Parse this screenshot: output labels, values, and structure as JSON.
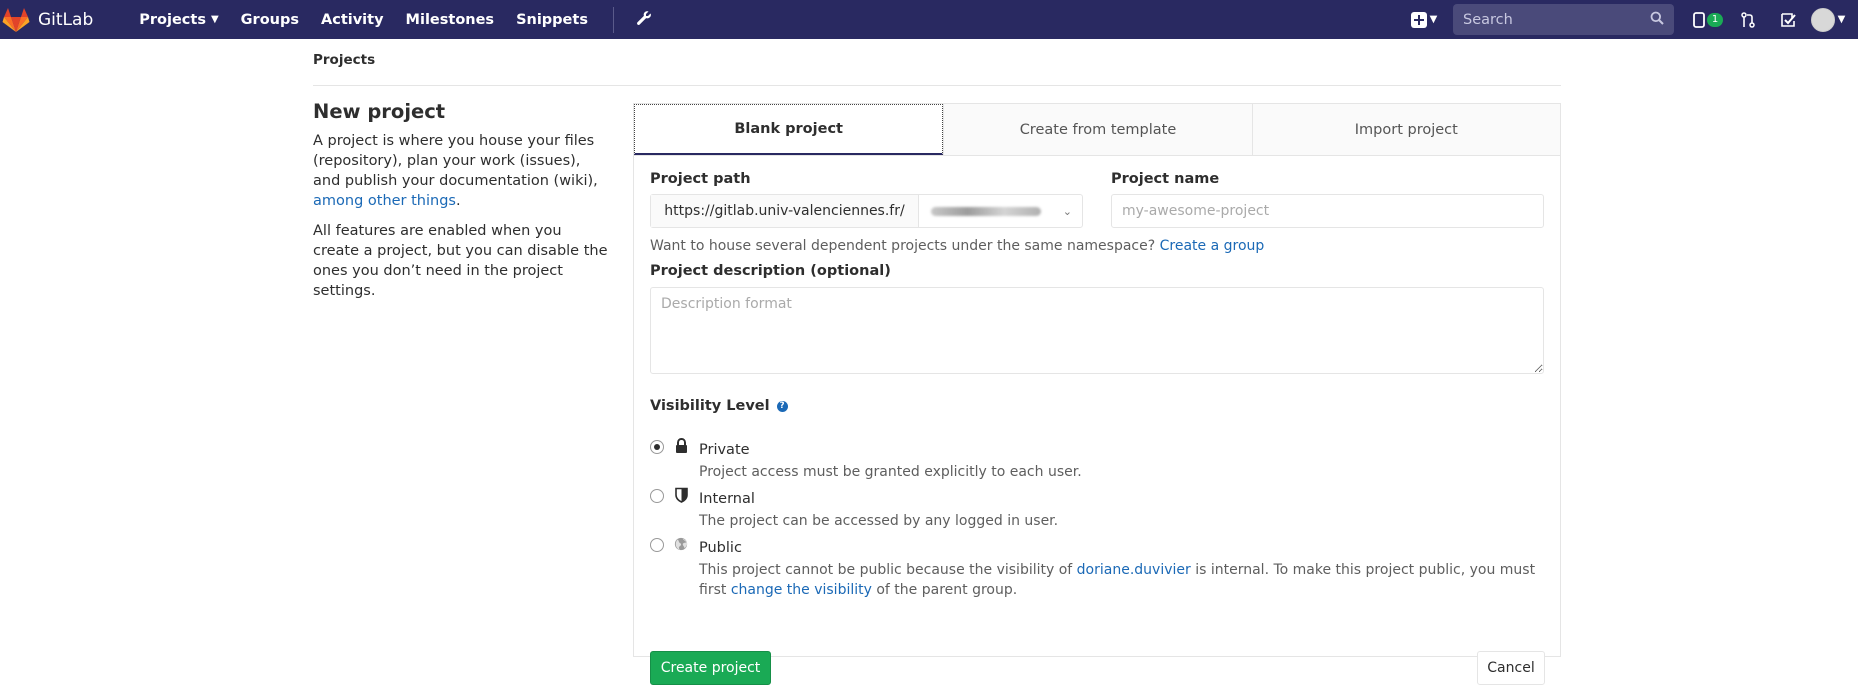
{
  "navbar": {
    "brand": "GitLab",
    "links": [
      {
        "label": "Projects",
        "has_dropdown": true
      },
      {
        "label": "Groups"
      },
      {
        "label": "Activity"
      },
      {
        "label": "Milestones"
      },
      {
        "label": "Snippets"
      }
    ],
    "search_placeholder": "Search",
    "issues_badge": "1",
    "icons": [
      "gitlab-logo-icon",
      "wrench-icon",
      "plus-icon",
      "search-icon",
      "issues-icon",
      "merge-request-icon",
      "todo-icon",
      "avatar"
    ]
  },
  "breadcrumb": "Projects",
  "intro": {
    "title": "New project",
    "p1_before": "A project is where you house your files (repository), plan your work (issues), and publish your documentation (wiki), ",
    "p1_link": "among other things",
    "p1_after": ".",
    "p2": "All features are enabled when you create a project, but you can disable the ones you don’t need in the project settings."
  },
  "tabs": [
    "Blank project",
    "Create from template",
    "Import project"
  ],
  "form": {
    "path_label": "Project path",
    "path_prefix": "https://gitlab.univ-valenciennes.fr/",
    "name_label": "Project name",
    "name_placeholder": "my-awesome-project",
    "hint_text": "Want to house several dependent projects under the same namespace? ",
    "hint_link": "Create a group",
    "desc_label": "Project description (optional)",
    "desc_placeholder": "Description format",
    "visibility_label": "Visibility Level",
    "visibility_options": [
      {
        "title": "Private",
        "desc": "Project access must be granted explicitly to each user.",
        "checked": true,
        "icon": "lock-icon"
      },
      {
        "title": "Internal",
        "desc": "The project can be accessed by any logged in user.",
        "checked": false,
        "icon": "shield-icon"
      },
      {
        "title": "Public",
        "desc_before": "This project cannot be public because the visibility of ",
        "desc_link1": "doriane.duvivier",
        "desc_middle": " is internal. To make this project public, you must first ",
        "desc_link2": "change the visibility",
        "desc_after": " of the parent group.",
        "checked": false,
        "icon": "globe-icon"
      }
    ],
    "create_label": "Create project",
    "cancel_label": "Cancel"
  },
  "colors": {
    "navbar": "#292961",
    "link": "#1b69b6",
    "primary_button": "#1aaa55"
  }
}
